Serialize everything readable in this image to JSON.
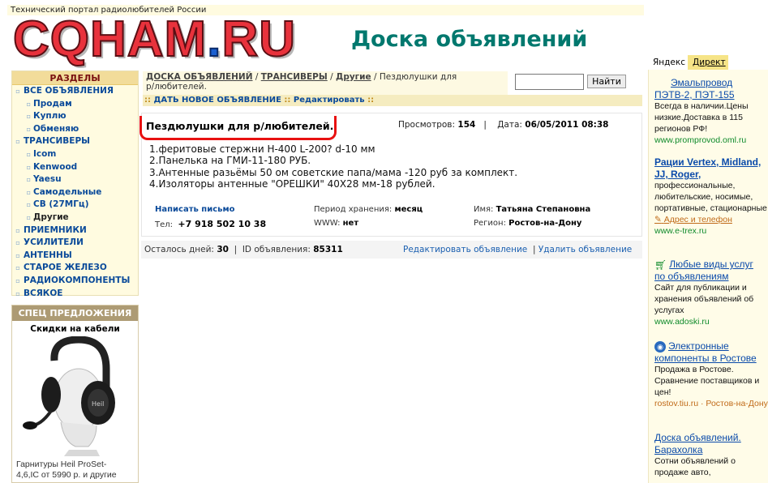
{
  "header": {
    "tagline": "Технический портал радиолюбителей России",
    "logo_main": "CQHAM",
    "logo_dot": ".",
    "logo_tld": "RU",
    "board_title": "Доска объявлений"
  },
  "sidebar": {
    "sections_title": "РАЗДЕЛЫ",
    "items": [
      {
        "label": "ВСЕ ОБЪЯВЛЕНИЯ",
        "level": 0
      },
      {
        "label": "Продам",
        "level": 1
      },
      {
        "label": "Куплю",
        "level": 1
      },
      {
        "label": "Обменяю",
        "level": 1
      },
      {
        "label": "ТРАНСИВЕРЫ",
        "level": 0
      },
      {
        "label": "Icom",
        "level": 1
      },
      {
        "label": "Kenwood",
        "level": 1
      },
      {
        "label": "Yaesu",
        "level": 1
      },
      {
        "label": "Самодельные",
        "level": 1
      },
      {
        "label": "CB (27МГц)",
        "level": 1
      },
      {
        "label": "Другие",
        "level": 1
      },
      {
        "label": "ПРИЕМНИКИ",
        "level": 0
      },
      {
        "label": "УСИЛИТЕЛИ",
        "level": 0
      },
      {
        "label": "АНТЕННЫ",
        "level": 0
      },
      {
        "label": "СТАРОЕ ЖЕЛЕЗО",
        "level": 0
      },
      {
        "label": "РАДИОКОМПОНЕНТЫ",
        "level": 0
      },
      {
        "label": "ВСЯКОЕ",
        "level": 0
      }
    ],
    "offers_title": "СПЕЦ ПРЕДЛОЖЕНИЯ",
    "offer_heading": "Скидки на кабели",
    "offer_caption_1": "Гарнитуры Heil ProSet-",
    "offer_caption_2": "4,6,IC от 5990 р. и другие"
  },
  "breadcrumb": {
    "crumb1": "ДОСКА ОБЪЯВЛЕНИЙ",
    "sep": " / ",
    "crumb2": "ТРАНСИВЕРЫ",
    "crumb3": "Другие",
    "current_1": "Пездюлушки для",
    "current_2": "р/любителей."
  },
  "search": {
    "placeholder": "",
    "value": "",
    "button": "Найти"
  },
  "actions": {
    "new_ad": "ДАТЬ НОВОЕ ОБЪЯВЛЕНИЕ",
    "edit": "Редактировать",
    "sep": "::"
  },
  "ad": {
    "title": "Пездюлушки для р/любителей.",
    "views_label": "Просмотров:",
    "views": "154",
    "date_label": "Дата:",
    "date": "06/05/2011 08:38",
    "body": [
      "1.феритовые стержни Н-400 L-200? d-10 мм",
      "2.Панелька на ГМИ-11-180 РУБ.",
      "3.Антенные разьёмы 50 ом советские папа/мама -120 руб за комплект.",
      "4.Изоляторы антенные \"ОРЕШКИ\" 40Х28 мм-18 рублей."
    ],
    "write_link": "Написать письмо",
    "phone_label": "Тел:",
    "phone": "+7 918 502 10 38",
    "period_label": "Период хранения:",
    "period": "месяц",
    "www_label": "WWW:",
    "www": "нет",
    "name_label": "Имя:",
    "name": "Татьяна Степановна",
    "region_label": "Регион:",
    "region": "Ростов-на-Дону"
  },
  "footer": {
    "days_label": "Осталось дней:",
    "days": "30",
    "id_label": "ID объявления:",
    "id": "85311",
    "edit_link": "Редактировать объявление",
    "delete_link": "Удалить объявление"
  },
  "right_ads": {
    "tab_yandex": "Яндекс",
    "tab_direct": "Директ",
    "items": [
      {
        "title_1": "Эмальпровод",
        "title_2": "ПЭТВ-2, ПЭТ-155",
        "text": "Всегда в наличии.Цены низкие.Доставка в 115 регионов РФ!",
        "url": "www.promprovod.oml.ru"
      },
      {
        "title_1": "Рации Vertex, Midland,",
        "title_2": "JJ, Roger,",
        "text": "профессиональные, любительские, носимые, портативные, стационарные",
        "extra": "Адрес и телефон",
        "url": "www.e-trex.ru"
      },
      {
        "title_1": "Любые виды услуг",
        "title_2": "по объявлениям",
        "text": "Сайт для публикации и хранения объявлений об услугах",
        "url": "www.adoski.ru"
      },
      {
        "title_1": "Электронные",
        "title_2": "компоненты в Ростове",
        "text": "Продажа в Ростове. Сравнение поставщиков и цен!",
        "url": "rostov.tiu.ru",
        "url_extra": "Ростов-на-Дону"
      },
      {
        "title_1": "Доска объявлений.",
        "title_2": "Барахолка",
        "text": "Сотни объявлений о продаже авто,",
        "url": ""
      }
    ]
  },
  "colors": {
    "logo_red": "#e8323c",
    "logo_blue": "#1a5fd0",
    "title_teal": "#00786e",
    "highlight_red": "#e81111",
    "link_blue": "#0a4a9a"
  }
}
